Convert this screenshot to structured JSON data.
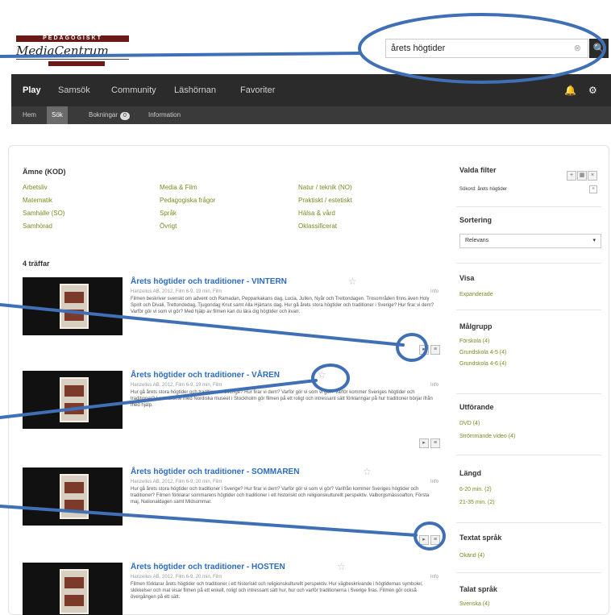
{
  "logo": {
    "top": "PEDAGOGISKT",
    "script": "MediaCentrum"
  },
  "search": {
    "value": "årets högtider",
    "clear": "⊗",
    "button": "🔍"
  },
  "nav": {
    "items": [
      "Play",
      "Samsök",
      "Community",
      "Läshörnan",
      "Favoriter"
    ],
    "bell": "🔔",
    "gear": "⚙"
  },
  "subnav": {
    "items": [
      "Hem",
      "Sök",
      "Bokningar",
      "Information"
    ],
    "badge": "0"
  },
  "subjects": {
    "title": "Ämne (KOD)",
    "col1": [
      "Arbetsliv",
      "Matematik",
      "Samhälle (SO)",
      "Samhörad"
    ],
    "col2": [
      "Media & Film",
      "Pedagogiska frågor",
      "Språk",
      "Övrigt"
    ],
    "col3": [
      "Natur / teknik (NO)",
      "Praktiskt / estetiskt",
      "Hälsa & vård",
      "Oklassificerat"
    ]
  },
  "hits": "4 träffar",
  "results": [
    {
      "title": "Årets högtider och traditioner - VINTERN",
      "meta": "Hanzelius AB, 2012, Film 6-9, 19 min, Film",
      "duration": "Info",
      "desc": "Filmen beskriver svenskt om advent och Ramadan, Pepparkakans dag, Lucia, Jullen, Nyår och Trettondagen. Trosområden finns även Holy Spirit och Divali, Trettondedag, Tjugondag Knut samt Alla Hjärtans dag. Hur gå årets stora högtider och traditioner i Sverige? Hur firar vi dem? Varför gör vi som vi gör? Med hjälp av filmen kan du lära dig högtider och kvarr."
    },
    {
      "title": "Årets högtider och traditioner - VÅREN",
      "meta": "Hanzelius AB, 2012, Film 6-9, 19 min, Film",
      "duration": "Info",
      "desc": "Hur gå årets stora högtider och traditioner i Sverige? Hur firar vi dem? Varför gör vi som vi gör? Varför kommer Sveriges högtider och traditioner? I samarbete med Nordiska museet i Stockholm gör filmen på ett roligt och intressant sätt förklaringar på hur traditioner börjar ifrån med hjälp."
    },
    {
      "title": "Årets högtider och traditioner - SOMMAREN",
      "meta": "Hanzelius AB, 2012, Film 6-9, 20 min, Film",
      "duration": "Info",
      "desc": "Hur gå årets stora högtider och traditioner i Sverige? Hur firar vi dem? Varför gör vi som vi gör? Varifrån kommer Sveriges högtider och traditioner? Filmen förklarar sommarens högtider och traditioner i ett historiskt och religionskulturellt perspektiv. Valborgsmässoafton, Första maj, Nationaldagen samt Midsommar."
    },
    {
      "title": "Årets högtider och traditioner - HÖSTEN",
      "meta": "Hanzelius AB, 2012, Film 6-9, 20 min, Film",
      "duration": "Info",
      "desc": "Filmen förklarar årets högtider och traditioner i ett historiskt och religionskulturellt perspektiv. Hur vägbeskrivande i högtidernas symboler, skikkelser och mat visar filmen på ett enkelt, roligt och intressant sätt hur, hur och varför traditionerna i Sverige firas. Filmen gör också övergången på ett sätt."
    }
  ],
  "sidebar": {
    "filters_title": "Valda filter",
    "chosen": "Sökord: årets högtider",
    "sort_title": "Sortering",
    "sort_value": "Relevans",
    "view_title": "Visa",
    "view_item": "Expanderade",
    "target_title": "Målgrupp",
    "target_items": [
      "Förskola (4)",
      "Grundskola 4-5 (4)",
      "Grundskola 4-6 (4)"
    ],
    "format_title": "Utförande",
    "format_items": [
      "DVD (4)",
      "Strömmande video (4)"
    ],
    "length_title": "Längd",
    "length_items": [
      "6-20 min. (2)",
      "21-35 min. (2)"
    ],
    "subtitle_title": "Textat språk",
    "subtitle_items": [
      "Okänd (4)"
    ],
    "spoken_title": "Talat språk",
    "spoken_items": [
      "Svenska (4)"
    ]
  }
}
